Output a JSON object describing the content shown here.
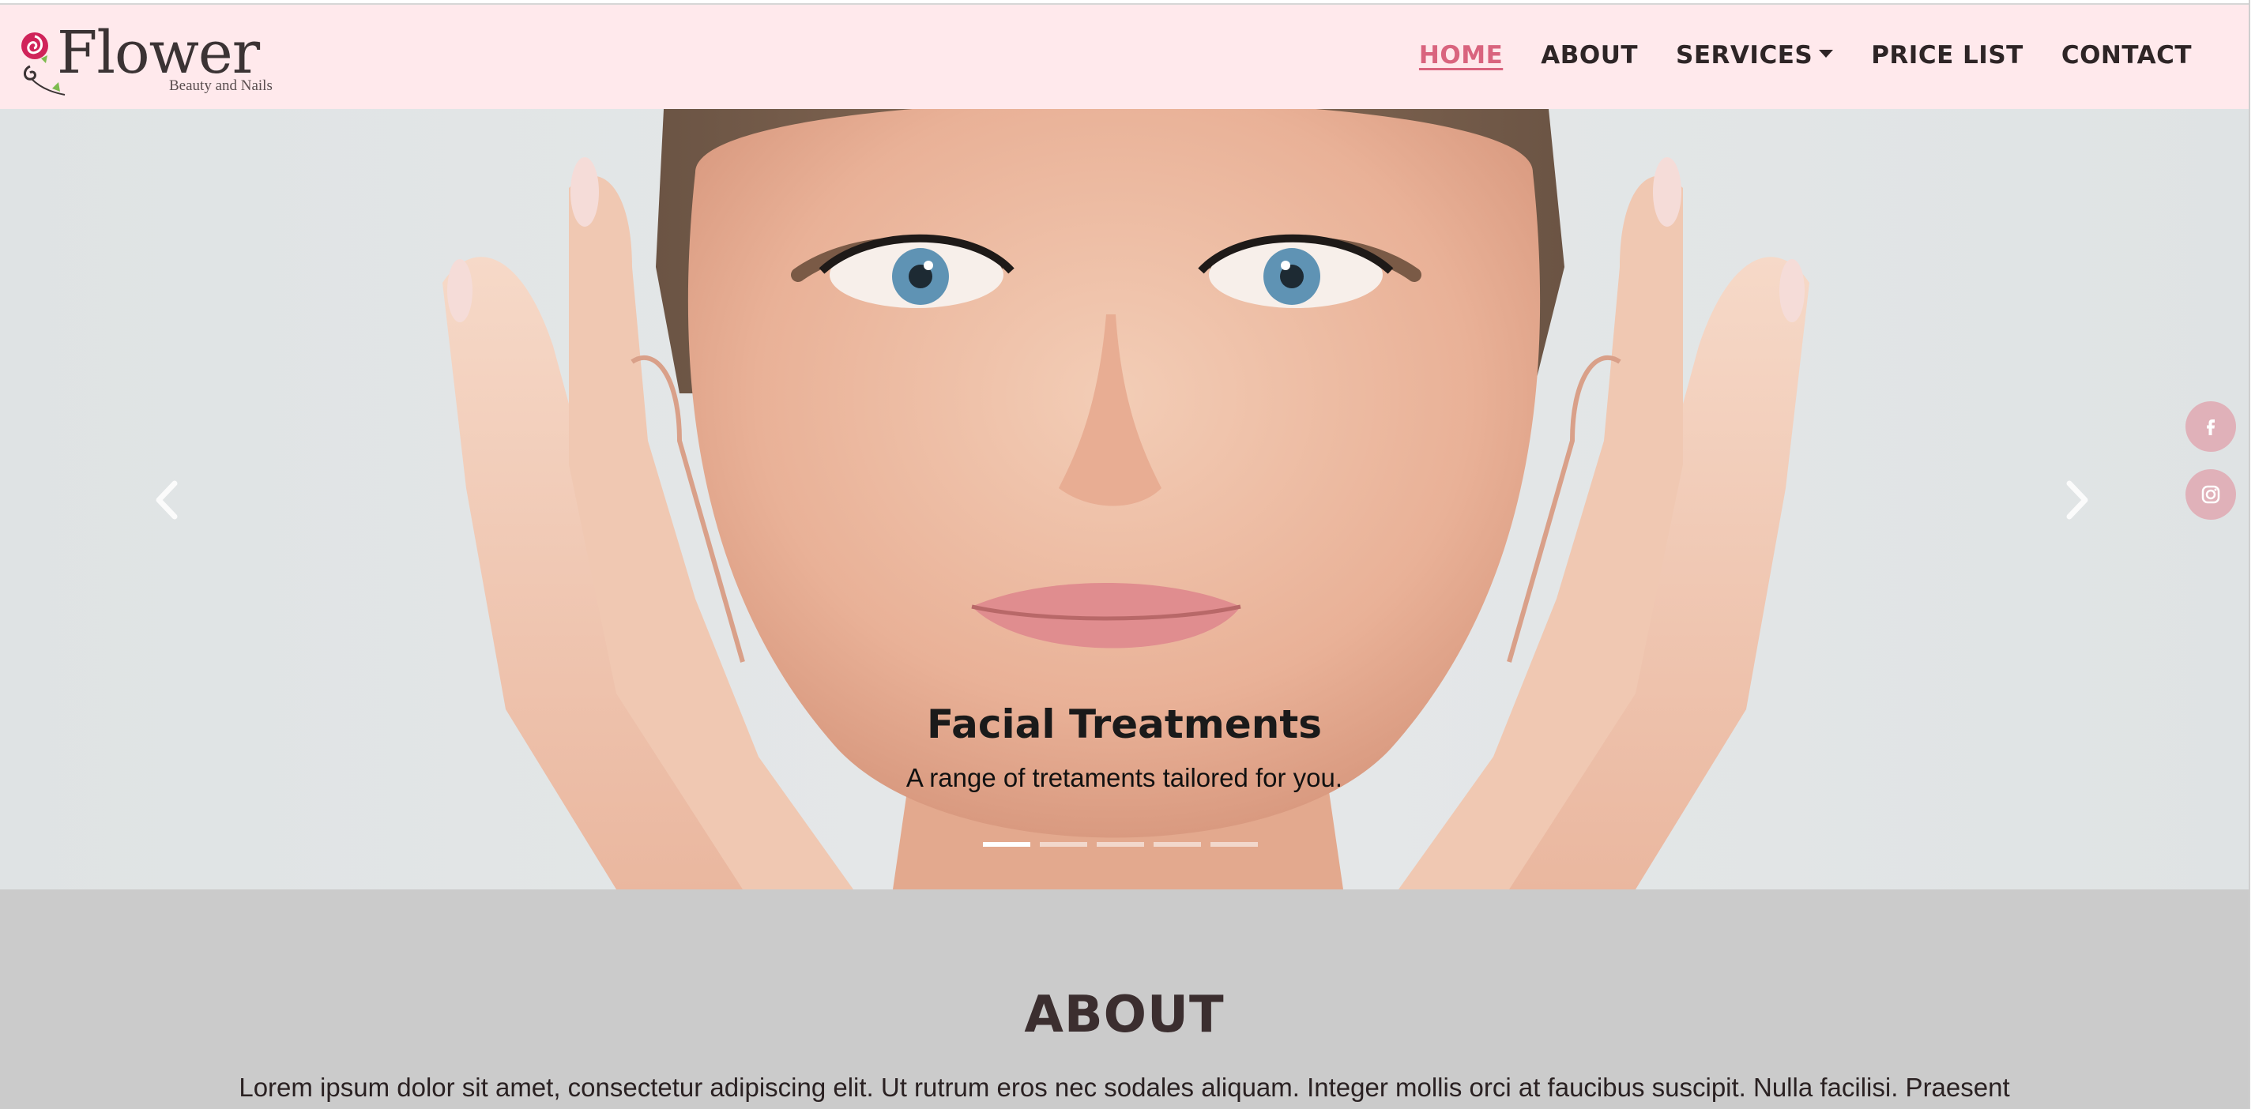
{
  "brand": {
    "name": "Flower",
    "tagline": "Beauty and Nails",
    "accent_color": "#d9647e",
    "nav_bg_color": "#ffe9ec"
  },
  "nav": {
    "items": [
      {
        "label": "HOME",
        "active": true
      },
      {
        "label": "ABOUT",
        "active": false
      },
      {
        "label": "SERVICES",
        "active": false,
        "dropdown": true
      },
      {
        "label": "PRICE LIST",
        "active": false
      },
      {
        "label": "CONTACT",
        "active": false
      }
    ]
  },
  "carousel": {
    "caption_title": "Facial Treatments",
    "caption_text": "A range of tretaments tailored for you.",
    "slide_count": 5,
    "active_index": 0,
    "prev_icon": "chevron-left-icon",
    "next_icon": "chevron-right-icon"
  },
  "social": {
    "facebook_icon": "facebook-icon",
    "instagram_icon": "instagram-icon",
    "color": "#e0b1b9"
  },
  "about": {
    "title": "ABOUT",
    "text": "Lorem ipsum dolor sit amet, consectetur adipiscing elit. Ut rutrum eros nec sodales aliquam. Integer mollis orci at faucibus suscipit. Nulla facilisi. Praesent"
  }
}
